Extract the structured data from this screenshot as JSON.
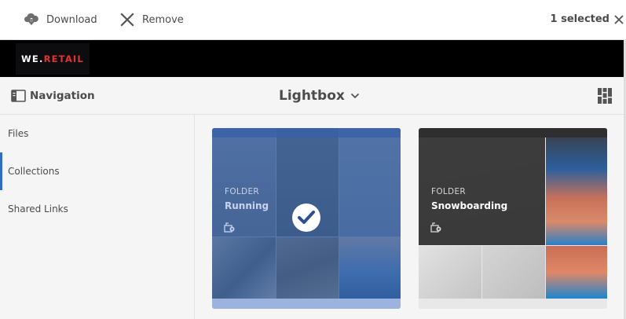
{
  "actionbar": {
    "download_label": "Download",
    "remove_label": "Remove",
    "selection_text": "1 selected",
    "icons": {
      "download": "cloud-download-icon",
      "remove": "close-icon",
      "close": "close-icon"
    }
  },
  "brand": {
    "logo_part1": "WE.",
    "logo_part2": "RETAIL",
    "logo_accent": "#e13232"
  },
  "toolbar": {
    "navigation_label": "Navigation",
    "title": "Lightbox",
    "icons": {
      "navigation": "rail-toggle-icon",
      "title_dropdown": "chevron-down-icon",
      "view": "card-view-icon"
    }
  },
  "sidebar": {
    "items": [
      {
        "label": "Files",
        "active": false
      },
      {
        "label": "Collections",
        "active": true
      },
      {
        "label": "Shared Links",
        "active": false
      }
    ],
    "active_color": "#326ec8"
  },
  "collections": [
    {
      "type": "FOLDER",
      "name": "Running",
      "selected": true,
      "icon": "shared-collection-icon",
      "selected_icon": "checkmark-circle-icon"
    },
    {
      "type": "FOLDER",
      "name": "Snowboarding",
      "selected": false,
      "icon": "shared-collection-icon"
    }
  ]
}
